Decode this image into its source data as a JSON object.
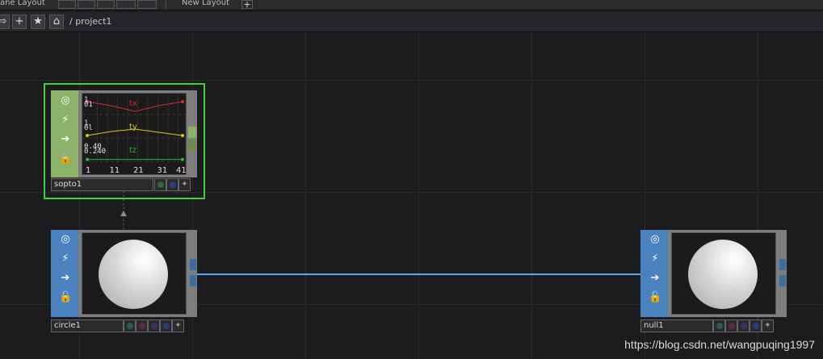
{
  "toolbar": {
    "pane_layout_label": "ane Layout",
    "new_layout_label": "New Layout",
    "new_layout_add": "+"
  },
  "pathbar": {
    "nav_back_glyph": "⇨",
    "add_glyph": "+",
    "star_glyph": "★",
    "home_glyph": "⌂",
    "path": "/ project1"
  },
  "nodes": {
    "sopto1": {
      "name": "sopto1",
      "icons": [
        "viewer-toggle-icon",
        "cook-icon",
        "export-icon",
        "lock-icon"
      ],
      "colors": {
        "side": "#8cb26a",
        "selection": "#3fd23a",
        "flag_dots": [
          "#2f6a3a",
          "#2f3f7a"
        ]
      },
      "chart_data": {
        "type": "line",
        "x": [
          1,
          11,
          21,
          31,
          41
        ],
        "x_ticks": [
          "1",
          "11",
          "21",
          "31",
          "41"
        ],
        "series": [
          {
            "name": "tx",
            "color": "#d62a2a",
            "top_value": "1",
            "bottom_value": "01",
            "values": [
              0.8,
              0.55,
              0.2,
              0.55,
              0.8
            ]
          },
          {
            "name": "ty",
            "color": "#d8c829",
            "top_value": "1",
            "bottom_value": "0l",
            "values": [
              0.15,
              0.4,
              0.55,
              0.35,
              0.15
            ]
          },
          {
            "name": "tz",
            "color": "#35b036",
            "top_value": "0.40",
            "bottom_value": "0.240",
            "values": [
              0.12,
              0.12,
              0.12,
              0.12,
              0.12
            ]
          }
        ]
      }
    },
    "circle1": {
      "name": "circle1",
      "icons": [
        "viewer-toggle-icon",
        "cook-icon",
        "export-icon",
        "lock-icon"
      ],
      "colors": {
        "side": "#4a82c0",
        "flag_dots": [
          "#2a5a55",
          "#5a2a4a",
          "#3a3270",
          "#2a3a7a"
        ]
      }
    },
    "null1": {
      "name": "null1",
      "icons": [
        "viewer-toggle-icon",
        "cook-icon",
        "export-icon",
        "lock-icon"
      ],
      "colors": {
        "side": "#4a82c0",
        "flag_dots": [
          "#2a5a55",
          "#5a2a4a",
          "#3a3270",
          "#2a3a7a"
        ]
      }
    }
  },
  "wire_color": "#5aa6ff",
  "watermark": "https://blog.csdn.net/wangpuqing1997"
}
